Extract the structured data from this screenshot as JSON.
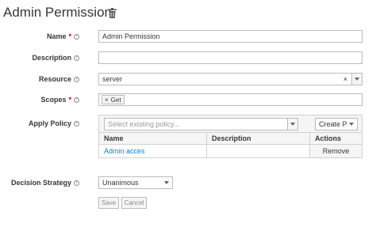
{
  "page": {
    "title": "Admin Permission"
  },
  "form": {
    "name": {
      "label": "Name",
      "required": "*",
      "value": "Admin Permission"
    },
    "description": {
      "label": "Description",
      "value": ""
    },
    "resource": {
      "label": "Resource",
      "value": "server",
      "clear": "×"
    },
    "scopes": {
      "label": "Scopes",
      "required": "*",
      "chips": [
        "Get"
      ]
    },
    "apply_policy": {
      "label": "Apply Policy",
      "placeholder": "Select existing policy...",
      "create_label": "Create P",
      "table": {
        "headers": [
          "Name",
          "Description",
          "Actions"
        ],
        "rows": [
          {
            "name": "Admin acces",
            "description": "",
            "action": "Remove"
          }
        ]
      }
    },
    "decision_strategy": {
      "label": "Decision Strategy",
      "value": "Unanimous"
    },
    "buttons": {
      "save": "Save",
      "cancel": "Cancel"
    }
  },
  "icons": {
    "help": "?",
    "chip_remove": "×"
  }
}
